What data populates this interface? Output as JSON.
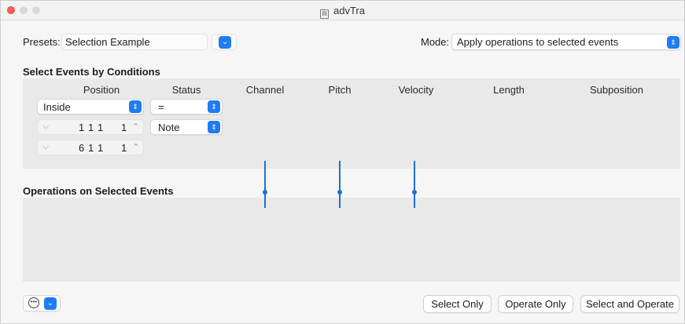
{
  "window": {
    "title": "advTra"
  },
  "presets": {
    "label": "Presets:",
    "value": "Selection Example"
  },
  "mode": {
    "label": "Mode:",
    "value": "Apply operations to selected events"
  },
  "select_section": {
    "title": "Select Events by Conditions",
    "columns": [
      "Position",
      "Status",
      "Channel",
      "Pitch",
      "Velocity",
      "Length",
      "Subposition"
    ],
    "position_condition": "Inside",
    "status_condition": "=",
    "status_value": "Note",
    "range_from": {
      "bar": "1",
      "beat": "1",
      "div": "1",
      "tick": "1"
    },
    "range_to": {
      "bar": "6",
      "beat": "1",
      "div": "1",
      "tick": "1"
    }
  },
  "operations_section": {
    "title": "Operations on Selected Events"
  },
  "buttons": {
    "select_only": "Select Only",
    "operate_only": "Operate Only",
    "select_and_operate": "Select and Operate"
  },
  "icons": {
    "action": "ellipsis-circle-icon",
    "popup": "chevron-updown-icon"
  },
  "colors": {
    "accent": "#1f7cf5",
    "connector": "#1f6fd6",
    "close": "#ff5f57"
  }
}
